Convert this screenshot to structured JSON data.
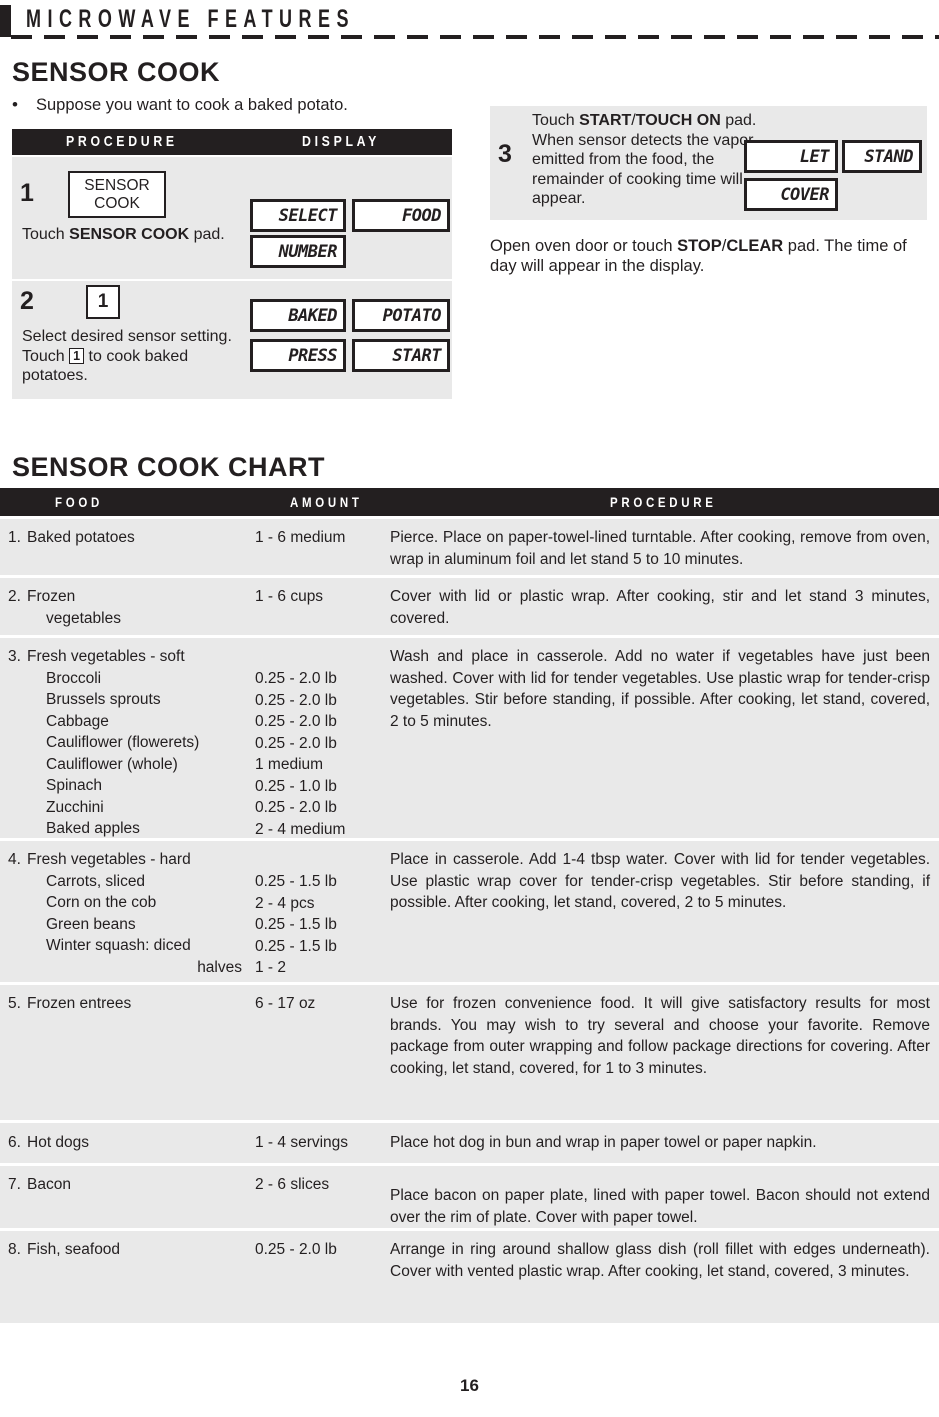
{
  "running_head": {
    "title": "MICROWAVE FEATURES"
  },
  "sections": {
    "sensor_cook_heading": "SENSOR COOK",
    "sensor_cook_chart_heading": "SENSOR COOK CHART"
  },
  "intro": {
    "bullet": "•",
    "text": "Suppose you want to cook a baked potato."
  },
  "procedure_table": {
    "headers": {
      "procedure": "PROCEDURE",
      "display": "DISPLAY"
    },
    "steps": [
      {
        "number": "1",
        "keycap": "SENSOR COOK",
        "instruction_pre": "Touch ",
        "instruction_bold": "SENSOR COOK",
        "instruction_post": " pad.",
        "displays": [
          "SELECT",
          "FOOD",
          "NUMBER"
        ]
      },
      {
        "number": "2",
        "keycap": "1",
        "instruction_pre": "Select desired sensor setting. Touch ",
        "instruction_key": "1",
        "instruction_post": " to cook baked potatoes.",
        "displays": [
          "BAKED",
          "POTATO",
          "PRESS",
          "START"
        ]
      },
      {
        "number": "3",
        "line1_pre": "Touch ",
        "line1_bold_a": "START",
        "line1_slash": "/",
        "line1_bold_b": "TOUCH ON",
        "line1_post": " pad.",
        "body": "When sensor detects the vapor emitted from the food, the remainder of cooking time will appear.",
        "displays": [
          "LET",
          "STAND",
          "COVER"
        ]
      }
    ]
  },
  "closing_note": {
    "pre": "Open oven door or touch ",
    "bold_a": "STOP",
    "slash": "/",
    "bold_b": "CLEAR",
    "post": " pad. The time of day will appear in the display."
  },
  "chart": {
    "headers": {
      "food": "FOOD",
      "amount": "AMOUNT",
      "procedure": "PROCEDURE"
    },
    "rows": [
      {
        "number": "1.",
        "food": "Baked potatoes",
        "sub_items": [],
        "amounts": [
          "1 - 6 medium"
        ],
        "procedure": "Pierce. Place on paper-towel-lined turntable. After cooking, remove from oven, wrap in aluminum foil and let stand 5 to 10 minutes."
      },
      {
        "number": "2.",
        "food": "Frozen",
        "food_line2": "vegetables",
        "sub_items": [],
        "amounts": [
          "1 - 6 cups"
        ],
        "procedure": "Cover with lid or plastic wrap. After cooking, stir and let stand 3 minutes, covered."
      },
      {
        "number": "3.",
        "food": "Fresh vegetables - soft",
        "sub_items": [
          "Broccoli",
          "Brussels sprouts",
          "Cabbage",
          "Cauliflower (flowerets)",
          "Cauliflower (whole)",
          "Spinach",
          "Zucchini",
          "Baked apples"
        ],
        "amounts": [
          "0.25 - 2.0 lb",
          "0.25 - 2.0 lb",
          "0.25 - 2.0 lb",
          "0.25 - 2.0 lb",
          "1 medium",
          "0.25 - 1.0 lb",
          "0.25 - 2.0 lb",
          "2 - 4 medium"
        ],
        "procedure": "Wash and place in casserole. Add no water if vegetables have just been washed. Cover with lid for tender vegetables. Use plastic wrap for tender-crisp vegetables. Stir before standing, if possible. After cooking, let stand, covered, 2 to 5 minutes."
      },
      {
        "number": "4.",
        "food": "Fresh vegetables - hard",
        "sub_items": [
          "Carrots, sliced",
          "Corn on the cob",
          "Green beans",
          "Winter squash: diced"
        ],
        "sub_items_right": [
          "halves"
        ],
        "amounts": [
          "0.25 - 1.5 lb",
          "2 - 4 pcs",
          "0.25 - 1.5 lb",
          "0.25 - 1.5 lb",
          "1 - 2"
        ],
        "procedure": "Place in casserole. Add 1-4 tbsp water. Cover with lid for tender vegetables. Use plastic wrap cover for tender-crisp vegetables. Stir before standing, if possible. After cooking, let stand, covered, 2 to 5 minutes."
      },
      {
        "number": "5.",
        "food": "Frozen entrees",
        "sub_items": [],
        "amounts": [
          "6 - 17 oz"
        ],
        "procedure": "Use for frozen convenience food. It will give satisfactory results for most brands. You may wish to try several and choose your favorite. Remove package from outer wrapping and follow package directions for covering. After cooking, let stand, covered, for 1 to 3 minutes."
      },
      {
        "number": "6.",
        "food": "Hot dogs",
        "sub_items": [],
        "amounts": [
          "1 - 4 servings"
        ],
        "procedure": "Place hot dog in bun and wrap in paper towel or paper napkin."
      },
      {
        "number": "7.",
        "food": "Bacon",
        "sub_items": [],
        "amounts": [
          "2 - 6 slices"
        ],
        "procedure": "Place bacon on paper plate, lined with paper towel. Bacon should not extend over the rim of plate. Cover with paper towel."
      },
      {
        "number": "8.",
        "food": "Fish, seafood",
        "sub_items": [],
        "amounts": [
          "0.25 - 2.0 lb"
        ],
        "procedure": "Arrange in ring around shallow glass dish (roll fillet with edges underneath). Cover with vented plastic wrap. After cooking, let stand, covered, 3 minutes."
      }
    ]
  },
  "page_number": "16",
  "colors": {
    "ink": "#231f20",
    "row_bg": "#e9e9e9",
    "page_bg": "#ffffff"
  }
}
